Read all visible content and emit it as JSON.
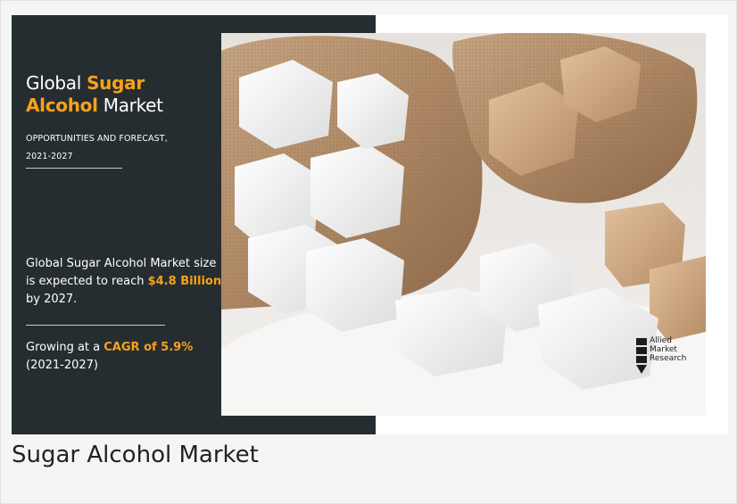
{
  "banner": {
    "title_prefix": "Global",
    "title_accent_1": "Sugar",
    "title_accent_2": "Alcohol",
    "title_suffix": "Market",
    "subhead_line_1": "OPPORTUNITIES AND FORECAST,",
    "subhead_line_2": "2021-2027",
    "size_text_1": "Global Sugar Alcohol Market size is expected to reach",
    "size_value": "$4.8 Billion",
    "size_text_2": "by 2027.",
    "cagr_text_1": "Growing at a",
    "cagr_value": "CAGR of 5.9%",
    "cagr_period": "(2021-2027)"
  },
  "logo": {
    "line_1": "Allied",
    "line_2": "Market",
    "line_3": "Research"
  },
  "caption": "Sugar Alcohol Market",
  "colors": {
    "accent": "#f7a21b",
    "panel": "#252d31"
  }
}
